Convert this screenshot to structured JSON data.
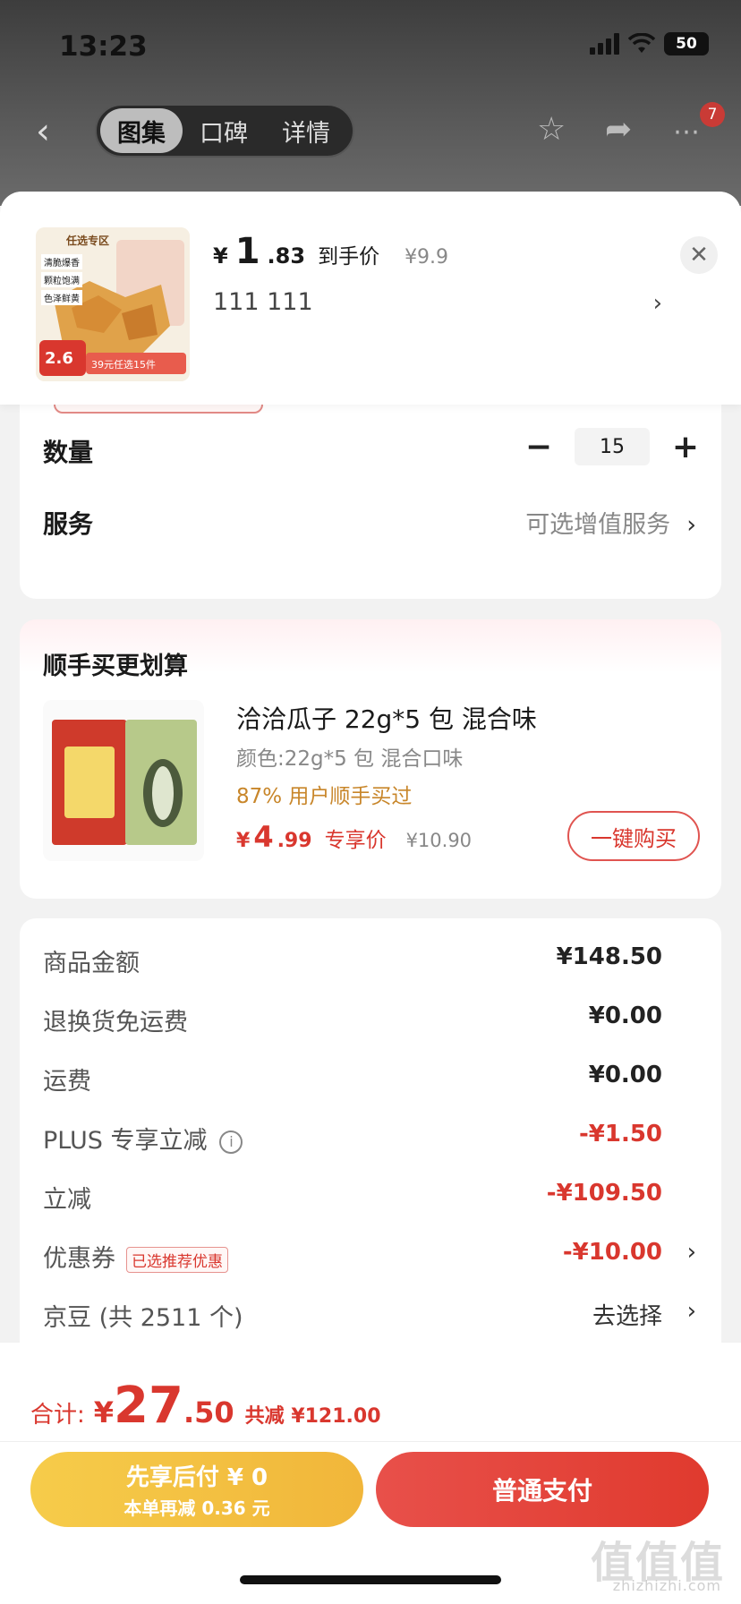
{
  "status_bar": {
    "time": "13:23",
    "battery": "50"
  },
  "nav": {
    "tabs": [
      "图集",
      "口碑",
      "详情"
    ],
    "active_tab": "图集",
    "cart_badge": "7"
  },
  "product": {
    "thumb_label": "任选专区",
    "thumb_tags": [
      "清脆爆香",
      "颗粒饱满",
      "色泽鲜黄"
    ],
    "thumb_price": "2.6",
    "thumb_promo": "39元任选15件",
    "price_yen": "¥",
    "price_int": "1",
    "price_dec": ".83",
    "price_tag": "到手价",
    "orig_price": "¥9.9",
    "sku": "111  111"
  },
  "selection": {
    "quantity_label": "数量",
    "quantity_value": "15",
    "service_label": "服务",
    "service_value": "可选增值服务"
  },
  "addon": {
    "title": "顺手买更划算",
    "name": "洽洽瓜子 22g*5 包 混合味",
    "spec": "颜色:22g*5 包 混合口味",
    "bought_pct": "87% 用户顺手买过",
    "price_yen": "¥",
    "price_int": "4",
    "price_dec": ".99",
    "price_tag": "专享价",
    "orig_price": "¥10.90",
    "buy_button": "一键购买"
  },
  "summary": {
    "rows": [
      {
        "label": "商品金额",
        "value": "¥148.50"
      },
      {
        "label": "退换货免运费",
        "value": "¥0.00"
      },
      {
        "label": "运费",
        "value": "¥0.00"
      },
      {
        "label": "PLUS 专享立减",
        "value": "-¥1.50"
      },
      {
        "label": "立减",
        "value": "-¥109.50"
      },
      {
        "label": "优惠券",
        "value": "-¥10.00",
        "chip": "已选推荐优惠"
      },
      {
        "label": "京豆 (共 2511 个)",
        "value": "去选择"
      }
    ]
  },
  "footer": {
    "total_label": "合计:",
    "total_yen": "¥",
    "total_int": "27",
    "total_dec": ".50",
    "total_saved": "共减 ¥121.00",
    "pay_later_line1": "先享后付 ¥ 0",
    "pay_later_line2": "本单再减 0.36 元",
    "pay_button": "普通支付"
  },
  "watermark": {
    "text": "值值值",
    "sub": "zhizhizhi.com"
  },
  "colors": {
    "accent": "#d9372e",
    "pay_later": "#f3c043",
    "badge": "#c93b36"
  }
}
